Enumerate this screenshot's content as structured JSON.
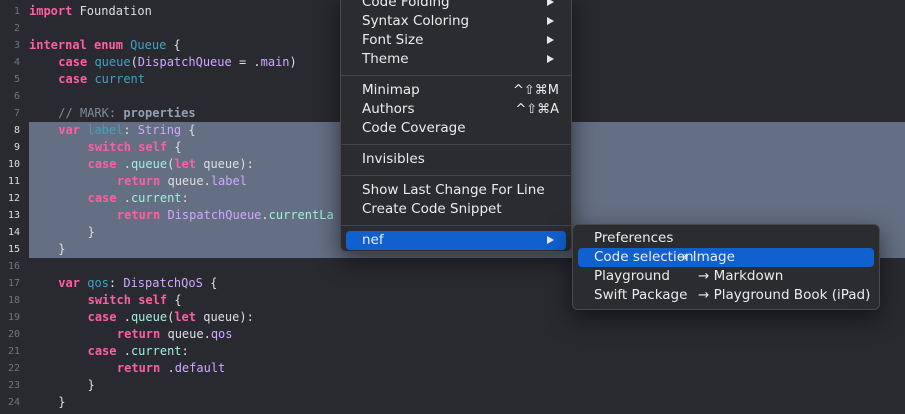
{
  "editor": {
    "lines": [
      {
        "n": "1",
        "indent": 0,
        "selected": false,
        "tokens": [
          [
            "keyword",
            "import"
          ],
          [
            "plain",
            " Foundation"
          ]
        ]
      },
      {
        "n": "2",
        "indent": 0,
        "selected": false,
        "tokens": []
      },
      {
        "n": "3",
        "indent": 0,
        "selected": false,
        "tokens": [
          [
            "keyword",
            "internal"
          ],
          [
            "plain",
            " "
          ],
          [
            "keyword",
            "enum"
          ],
          [
            "plain",
            " "
          ],
          [
            "decl",
            "Queue"
          ],
          [
            "plain",
            " {"
          ]
        ]
      },
      {
        "n": "4",
        "indent": 1,
        "selected": false,
        "tokens": [
          [
            "keyword",
            "case"
          ],
          [
            "plain",
            " "
          ],
          [
            "decl",
            "queue"
          ],
          [
            "plain",
            "("
          ],
          [
            "type",
            "DispatchQueue"
          ],
          [
            "plain",
            " = ."
          ],
          [
            "type",
            "main"
          ],
          [
            "plain",
            ")"
          ]
        ]
      },
      {
        "n": "5",
        "indent": 1,
        "selected": false,
        "tokens": [
          [
            "keyword",
            "case"
          ],
          [
            "plain",
            " "
          ],
          [
            "decl",
            "current"
          ]
        ]
      },
      {
        "n": "6",
        "indent": 0,
        "selected": false,
        "tokens": []
      },
      {
        "n": "7",
        "indent": 1,
        "selected": false,
        "tokens": [
          [
            "comment",
            "// MARK: "
          ],
          [
            "mark",
            "properties"
          ]
        ]
      },
      {
        "n": "8",
        "indent": 1,
        "selected": true,
        "tokens": [
          [
            "keyword",
            "var"
          ],
          [
            "plain",
            " "
          ],
          [
            "decl",
            "label"
          ],
          [
            "plain",
            ": "
          ],
          [
            "type",
            "String"
          ],
          [
            "plain",
            " {"
          ]
        ]
      },
      {
        "n": "9",
        "indent": 2,
        "selected": true,
        "tokens": [
          [
            "keyword",
            "switch"
          ],
          [
            "plain",
            " "
          ],
          [
            "keyword",
            "self"
          ],
          [
            "plain",
            " {"
          ]
        ]
      },
      {
        "n": "10",
        "indent": 2,
        "selected": true,
        "tokens": [
          [
            "keyword",
            "case"
          ],
          [
            "plain",
            " ."
          ],
          [
            "proj",
            "queue"
          ],
          [
            "plain",
            "("
          ],
          [
            "keyword",
            "let"
          ],
          [
            "plain",
            " queue):"
          ]
        ]
      },
      {
        "n": "11",
        "indent": 3,
        "selected": true,
        "tokens": [
          [
            "keyword",
            "return"
          ],
          [
            "plain",
            " queue."
          ],
          [
            "type",
            "label"
          ]
        ]
      },
      {
        "n": "12",
        "indent": 2,
        "selected": true,
        "tokens": [
          [
            "keyword",
            "case"
          ],
          [
            "plain",
            " ."
          ],
          [
            "proj",
            "current"
          ],
          [
            "plain",
            ":"
          ]
        ]
      },
      {
        "n": "13",
        "indent": 3,
        "selected": true,
        "tokens": [
          [
            "keyword",
            "return"
          ],
          [
            "plain",
            " "
          ],
          [
            "type",
            "DispatchQueue"
          ],
          [
            "plain",
            "."
          ],
          [
            "proj",
            "currentLa"
          ]
        ]
      },
      {
        "n": "14",
        "indent": 2,
        "selected": true,
        "tokens": [
          [
            "plain",
            "}"
          ]
        ]
      },
      {
        "n": "15",
        "indent": 1,
        "selected": true,
        "tokens": [
          [
            "plain",
            "}"
          ]
        ]
      },
      {
        "n": "16",
        "indent": 0,
        "selected": false,
        "tokens": []
      },
      {
        "n": "17",
        "indent": 1,
        "selected": false,
        "tokens": [
          [
            "keyword",
            "var"
          ],
          [
            "plain",
            " "
          ],
          [
            "decl",
            "qos"
          ],
          [
            "plain",
            ": "
          ],
          [
            "type",
            "DispatchQoS"
          ],
          [
            "plain",
            " {"
          ]
        ]
      },
      {
        "n": "18",
        "indent": 2,
        "selected": false,
        "tokens": [
          [
            "keyword",
            "switch"
          ],
          [
            "plain",
            " "
          ],
          [
            "keyword",
            "self"
          ],
          [
            "plain",
            " {"
          ]
        ]
      },
      {
        "n": "19",
        "indent": 2,
        "selected": false,
        "tokens": [
          [
            "keyword",
            "case"
          ],
          [
            "plain",
            " ."
          ],
          [
            "proj",
            "queue"
          ],
          [
            "plain",
            "("
          ],
          [
            "keyword",
            "let"
          ],
          [
            "plain",
            " queue):"
          ]
        ]
      },
      {
        "n": "20",
        "indent": 3,
        "selected": false,
        "tokens": [
          [
            "keyword",
            "return"
          ],
          [
            "plain",
            " queue."
          ],
          [
            "type",
            "qos"
          ]
        ]
      },
      {
        "n": "21",
        "indent": 2,
        "selected": false,
        "tokens": [
          [
            "keyword",
            "case"
          ],
          [
            "plain",
            " ."
          ],
          [
            "proj",
            "current"
          ],
          [
            "plain",
            ":"
          ]
        ]
      },
      {
        "n": "22",
        "indent": 3,
        "selected": false,
        "tokens": [
          [
            "keyword",
            "return"
          ],
          [
            "plain",
            " ."
          ],
          [
            "type",
            "default"
          ]
        ]
      },
      {
        "n": "23",
        "indent": 2,
        "selected": false,
        "tokens": [
          [
            "plain",
            "}"
          ]
        ]
      },
      {
        "n": "24",
        "indent": 1,
        "selected": false,
        "tokens": [
          [
            "plain",
            "}"
          ]
        ]
      }
    ]
  },
  "main_menu": {
    "items": [
      {
        "label": "Code Folding",
        "submenu": true
      },
      {
        "label": "Syntax Coloring",
        "submenu": true
      },
      {
        "label": "Font Size",
        "submenu": true
      },
      {
        "label": "Theme",
        "submenu": true
      },
      {
        "separator": true
      },
      {
        "label": "Minimap",
        "shortcut": "^⇧⌘M"
      },
      {
        "label": "Authors",
        "shortcut": "^⇧⌘A"
      },
      {
        "label": "Code Coverage"
      },
      {
        "separator": true
      },
      {
        "label": "Invisibles"
      },
      {
        "separator": true
      },
      {
        "label": "Show Last Change For Line"
      },
      {
        "label": "Create Code Snippet"
      },
      {
        "separator": true
      },
      {
        "label": "nef",
        "submenu": true,
        "highlighted": true
      }
    ]
  },
  "sub_menu": {
    "items": [
      {
        "label": "Preferences",
        "target": ""
      },
      {
        "label": "Code selection",
        "target": "→ Image",
        "highlighted": true
      },
      {
        "label": "Playground",
        "target": "→ Markdown"
      },
      {
        "label": "Swift Package",
        "target": "→ Playground Book (iPad)"
      }
    ]
  },
  "colors": {
    "background": "#292a30",
    "selection": "#646f83",
    "menu_highlight": "#1160d0",
    "keyword": "#fc5fa3",
    "type": "#d0a8ff",
    "declaration": "#41a1c0",
    "comment": "#7f8c98"
  }
}
